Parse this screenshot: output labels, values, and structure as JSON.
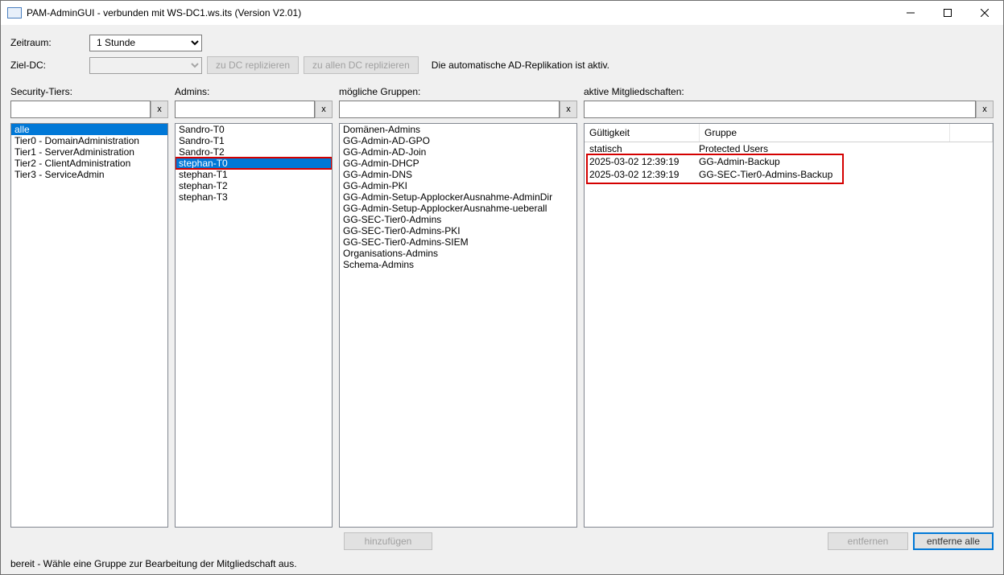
{
  "window": {
    "title": "PAM-AdminGUI - verbunden mit WS-DC1.ws.its (Version V2.01)"
  },
  "labels": {
    "zeitraum": "Zeitraum:",
    "ziel_dc": "Ziel-DC:",
    "security_tiers": "Security-Tiers:",
    "admins": "Admins:",
    "groups": "mögliche Gruppen:",
    "memberships": "aktive Mitgliedschaften:"
  },
  "top": {
    "zeitraum_value": "1 Stunde",
    "ziel_value": "",
    "btn_replicate_dc": "zu DC replizieren",
    "btn_replicate_all": "zu allen DC replizieren",
    "info_text": "Die automatische AD-Replikation ist aktiv."
  },
  "filter_clear": "x",
  "tiers": {
    "items": [
      {
        "label": "alle",
        "selected": true
      },
      {
        "label": "Tier0 - DomainAdministration"
      },
      {
        "label": "Tier1 - ServerAdministration"
      },
      {
        "label": "Tier2 - ClientAdministration"
      },
      {
        "label": "Tier3 - ServiceAdmin"
      }
    ]
  },
  "admins": {
    "items": [
      {
        "label": "Sandro-T0"
      },
      {
        "label": "Sandro-T1"
      },
      {
        "label": "Sandro-T2"
      },
      {
        "label": "stephan-T0",
        "selected": true,
        "highlight": true
      },
      {
        "label": "stephan-T1"
      },
      {
        "label": "stephan-T2"
      },
      {
        "label": "stephan-T3"
      }
    ]
  },
  "groups": {
    "items": [
      "Domänen-Admins",
      "GG-Admin-AD-GPO",
      "GG-Admin-AD-Join",
      "GG-Admin-DHCP",
      "GG-Admin-DNS",
      "GG-Admin-PKI",
      "GG-Admin-Setup-ApplockerAusnahme-AdminDir",
      "GG-Admin-Setup-ApplockerAusnahme-ueberall",
      "GG-SEC-Tier0-Admins",
      "GG-SEC-Tier0-Admins-PKI",
      "GG-SEC-Tier0-Admins-SIEM",
      "Organisations-Admins",
      "Schema-Admins"
    ]
  },
  "memberships": {
    "col_validity": "Gültigkeit",
    "col_group": "Gruppe",
    "rows": [
      {
        "validity": "statisch",
        "group": "Protected Users"
      },
      {
        "validity": "2025-03-02 12:39:19",
        "group": "GG-Admin-Backup"
      },
      {
        "validity": "2025-03-02 12:39:19",
        "group": "GG-SEC-Tier0-Admins-Backup"
      }
    ]
  },
  "buttons": {
    "add": "hinzufügen",
    "remove": "entfernen",
    "remove_all": "entferne alle"
  },
  "status": "bereit - Wähle eine Gruppe zur Bearbeitung der Mitgliedschaft aus."
}
